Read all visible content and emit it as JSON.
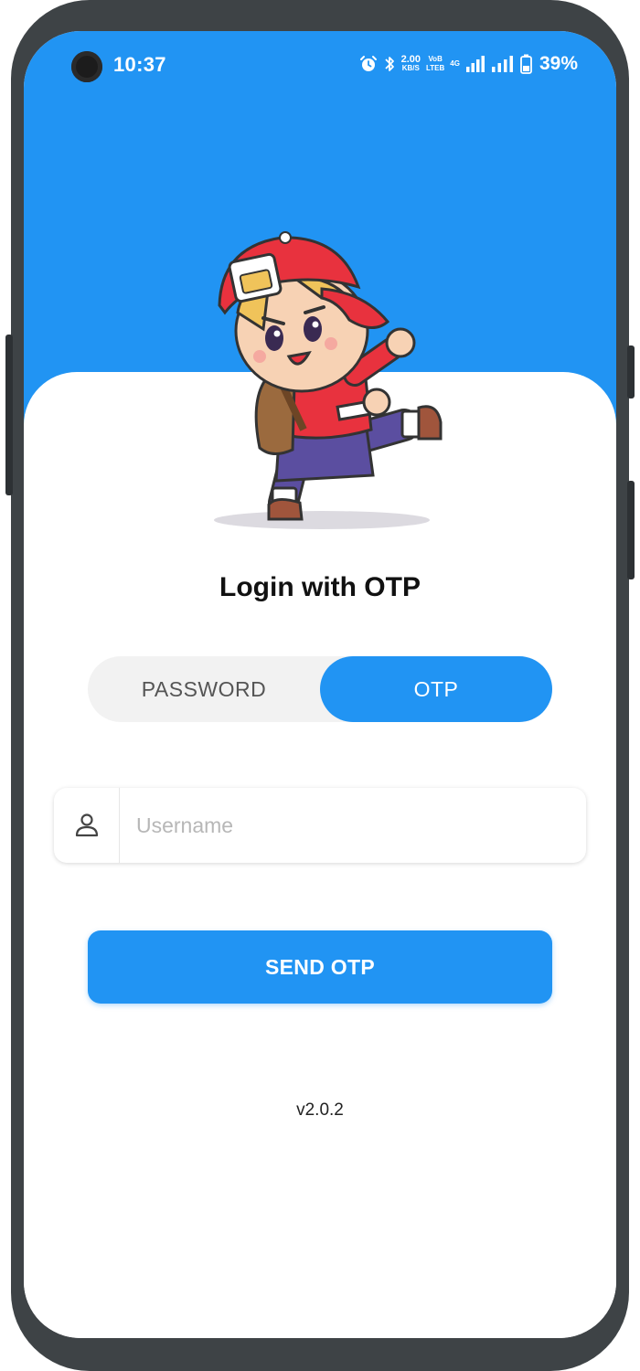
{
  "status_bar": {
    "time": "10:37",
    "net_speed_value": "2.00",
    "net_speed_unit": "KB/S",
    "volte_top": "VoB",
    "volte_bottom": "LTEB",
    "network_type": "4G",
    "battery": "39%"
  },
  "login": {
    "title": "Login with OTP"
  },
  "toggle": {
    "password_label": "PASSWORD",
    "otp_label": "OTP",
    "selected": "OTP"
  },
  "username": {
    "placeholder": "Username",
    "value": ""
  },
  "send_button": {
    "label": "SEND OTP"
  },
  "version": "v2.0.2",
  "colors": {
    "primary": "#2194f3",
    "toggle_bg": "#f2f2f2",
    "frame": "#3e4346"
  }
}
